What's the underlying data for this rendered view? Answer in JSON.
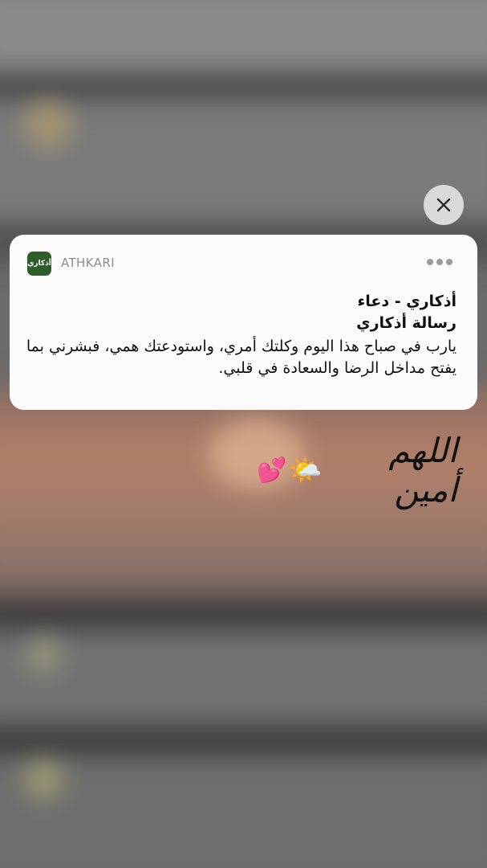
{
  "notification": {
    "app_name": "ATHKARI",
    "app_icon_text": "أذكاري",
    "title": "أذكاري - دعاء",
    "subtitle": "رسالة أذكاري",
    "body": "يارب في صباح هذا اليوم وكلتك أمري، واستودعتك همي، فبشرني بما يفتح مداخل الرضا والسعادة في قلبي."
  },
  "caption": {
    "text": "اللهم أمين",
    "emoji_sun": "🌤️",
    "emoji_hearts": "💕"
  },
  "icons": {
    "close": "close-icon",
    "more": "more-icon"
  }
}
